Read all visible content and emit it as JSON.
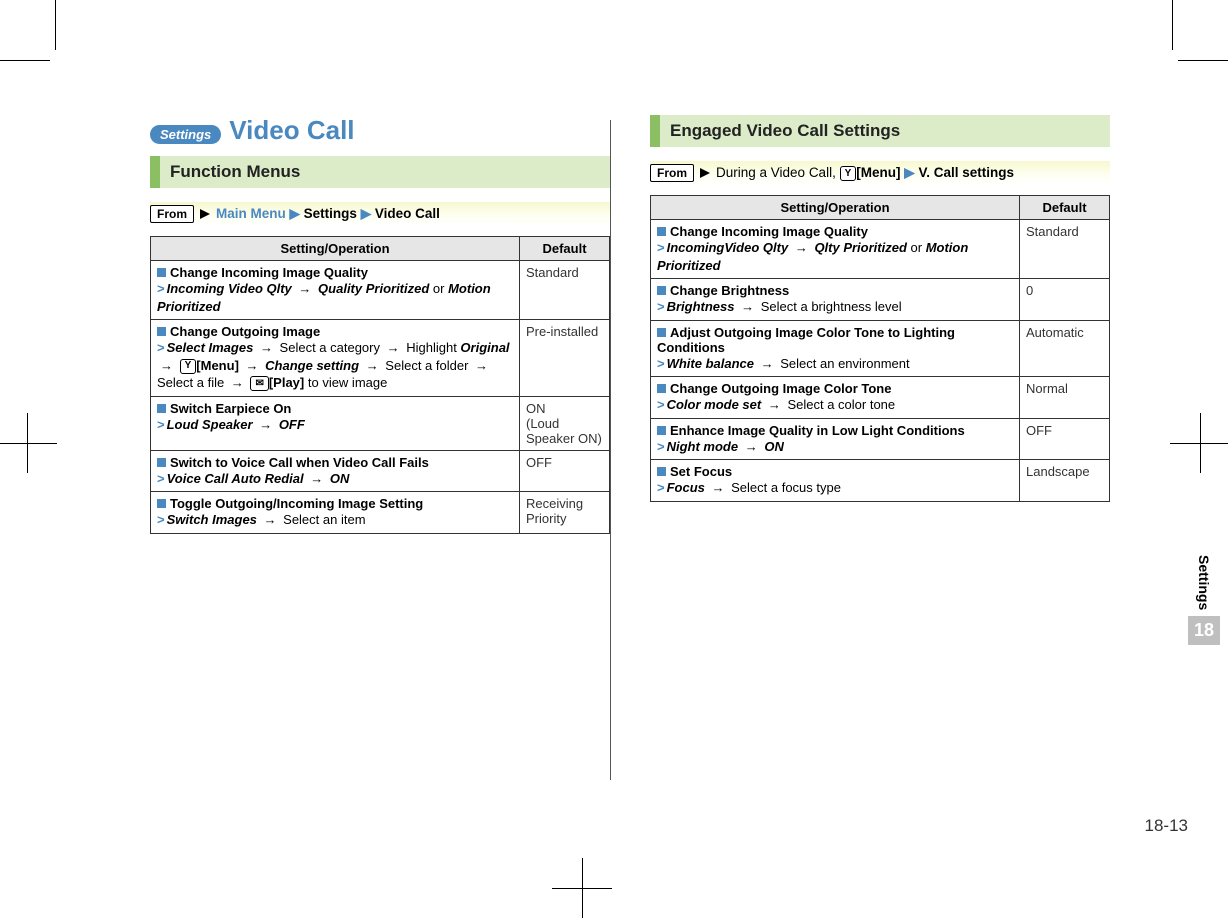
{
  "badge": "Settings",
  "title": "Video Call",
  "section_left": "Function Menus",
  "from_left_prefix": "From",
  "from_left_text_1": "Main Menu",
  "from_left_text_2": "Settings",
  "from_left_text_3": "Video Call",
  "th_setting": "Setting/Operation",
  "th_default": "Default",
  "left_rows": [
    {
      "title": "Change Incoming Image Quality",
      "op_html": "<span class='gt'>&gt;</span><span class='i'>Incoming Video Qlty</span> <span class='arrow'>→</span> <span class='i'>Quality Prioritized</span> or <span class='i'>Motion Prioritized</span>",
      "default": "Standard"
    },
    {
      "title": "Change Outgoing Image",
      "op_html": "<span class='gt'>&gt;</span><span class='i'>Select Images</span> <span class='arrow'>→</span> Select a category <span class='arrow'>→</span> Highlight <span class='i'>Original</span> <span class='arrow'>→</span> <span class='key-icon'>Y</span><span class='b'>[Menu]</span> <span class='arrow'>→</span> <span class='i'>Change setting</span> <span class='arrow'>→</span> Select a folder <span class='arrow'>→</span> Select a file <span class='arrow'>→</span> <span class='key-icon'>✉</span><span class='b'>[Play]</span> to view image",
      "default": "Pre-installed"
    },
    {
      "title": "Switch Earpiece On",
      "op_html": "<span class='gt'>&gt;</span><span class='i'>Loud Speaker</span> <span class='arrow'>→</span> <span class='i'>OFF</span>",
      "default": "ON\n(Loud Speaker ON)"
    },
    {
      "title": "Switch to Voice Call when Video Call Fails",
      "op_html": "<span class='gt'>&gt;</span><span class='i'>Voice Call Auto Redial</span> <span class='arrow'>→</span> <span class='i'>ON</span>",
      "default": "OFF"
    },
    {
      "title": "Toggle Outgoing/Incoming Image Setting",
      "op_html": "<span class='gt'>&gt;</span><span class='i'>Switch Images</span> <span class='arrow'>→</span> Select an item",
      "default": "Receiving Priority"
    }
  ],
  "section_right": "Engaged Video Call Settings",
  "from_right_prefix": "From",
  "from_right_text_1": "During a Video Call,",
  "from_right_menu": "[Menu]",
  "from_right_text_2": "V. Call settings",
  "right_rows": [
    {
      "title": "Change Incoming Image Quality",
      "op_html": "<span class='gt'>&gt;</span><span class='i'>IncomingVideo Qlty</span> <span class='arrow'>→</span> <span class='i'>Qlty Prioritized</span> or <span class='i'>Motion Prioritized</span>",
      "default": "Standard"
    },
    {
      "title": "Change Brightness",
      "op_html": "<span class='gt'>&gt;</span><span class='i'>Brightness</span> <span class='arrow'>→</span> Select a brightness level",
      "default": "0"
    },
    {
      "title": "Adjust Outgoing Image Color Tone to Lighting Conditions",
      "op_html": "<span class='gt'>&gt;</span><span class='i'>White balance</span> <span class='arrow'>→</span> Select an environment",
      "default": "Automatic"
    },
    {
      "title": "Change Outgoing Image Color Tone",
      "op_html": "<span class='gt'>&gt;</span><span class='i'>Color mode set</span> <span class='arrow'>→</span> Select a color tone",
      "default": "Normal"
    },
    {
      "title": "Enhance Image Quality in Low Light Conditions",
      "op_html": "<span class='gt'>&gt;</span><span class='i'>Night mode</span> <span class='arrow'>→</span> <span class='i'>ON</span>",
      "default": "OFF"
    },
    {
      "title": "Set Focus",
      "op_html": "<span class='gt'>&gt;</span><span class='i'>Focus</span> <span class='arrow'>→</span> Select a focus type",
      "default": "Landscape"
    }
  ],
  "side_tab_label": "Settings",
  "side_tab_num": "18",
  "page_num": "18-13"
}
